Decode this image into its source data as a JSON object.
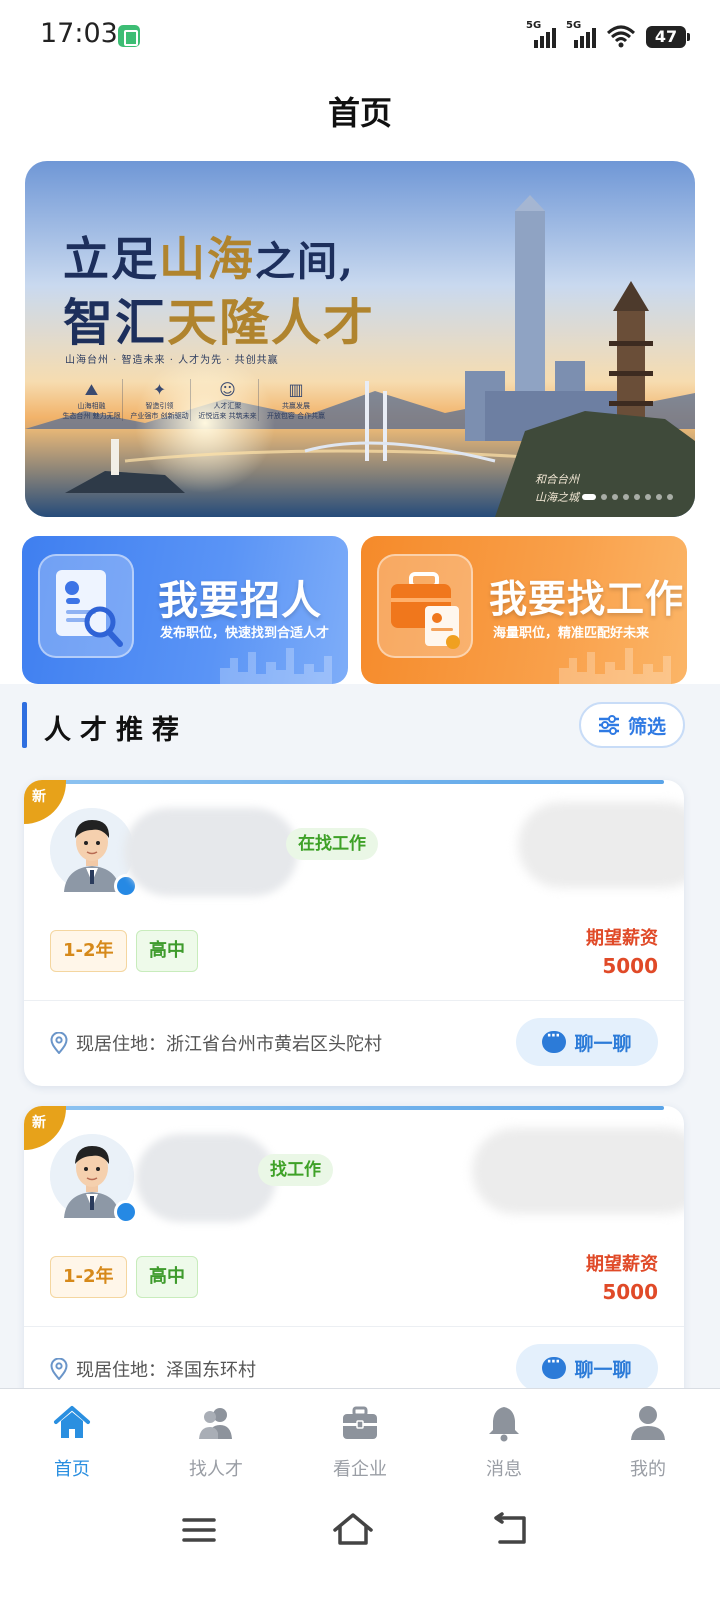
{
  "status_bar": {
    "time": "17:03",
    "signal_1": "5G",
    "signal_2": "5G",
    "battery": "47"
  },
  "header": {
    "title": "首页"
  },
  "banner": {
    "headline_1_a": "立足",
    "headline_1_b": "山海",
    "headline_1_c": "之间,",
    "headline_2_a": "智汇",
    "headline_2_b": "天隆人才",
    "subline": "山海台州 · 智造未来 · 人才为先 · 共创共赢",
    "features": [
      {
        "title": "山海相融",
        "desc": "生态台州 魅力无限"
      },
      {
        "title": "智造引领",
        "desc": "产业强市 创新驱动"
      },
      {
        "title": "人才汇聚",
        "desc": "近悦远来 共筑未来"
      },
      {
        "title": "共赢发展",
        "desc": "开放包容 合作共赢"
      }
    ],
    "seal_1": "和合台州",
    "seal_2": "山海之城",
    "slide_count": 8,
    "active_slide": 1
  },
  "actions": {
    "recruit": {
      "title": "我要招人",
      "subtitle": "发布职位，快速找到合适人才",
      "icon": "resume-search-icon"
    },
    "job": {
      "title": "我要找工作",
      "subtitle": "海量职位，精准匹配好未来",
      "icon": "briefcase-icon"
    }
  },
  "talent_section": {
    "title": "人才推荐",
    "filter_label": "筛选",
    "cards": [
      {
        "badge": "新",
        "status": "在找工作",
        "experience": "1-2年",
        "education": "高中",
        "salary_label": "期望薪资",
        "salary_value": "5000",
        "location": "现居住地：浙江省台州市黄岩区头陀村",
        "chat_label": "聊一聊"
      },
      {
        "badge": "新",
        "status": "找工作",
        "experience": "1-2年",
        "education": "高中",
        "salary_label": "期望薪资",
        "salary_value": "5000",
        "location": "现居住地：泽国东环村",
        "chat_label": "聊一聊"
      }
    ]
  },
  "bottom_nav": {
    "items": [
      {
        "label": "首页",
        "icon": "home-icon",
        "active": true
      },
      {
        "label": "找人才",
        "icon": "people-icon",
        "active": false
      },
      {
        "label": "看企业",
        "icon": "briefcase-icon",
        "active": false
      },
      {
        "label": "消息",
        "icon": "bell-icon",
        "active": false
      },
      {
        "label": "我的",
        "icon": "user-icon",
        "active": false
      }
    ]
  },
  "colors": {
    "accent": "#2a8fe0",
    "recruit_card": "#4a87f2",
    "job_card": "#f7922f",
    "salary": "#e04a28",
    "new_badge": "#e7a21a"
  }
}
